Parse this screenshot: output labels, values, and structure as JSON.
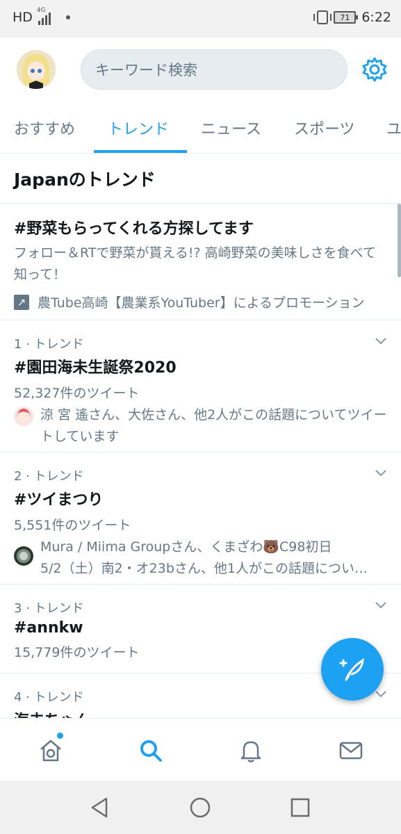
{
  "status_bar": {
    "left_label": "HD",
    "network": "4G",
    "battery": "71",
    "time": "6:22"
  },
  "header": {
    "search_placeholder": "キーワード検索"
  },
  "tabs": [
    {
      "label": "おすすめ"
    },
    {
      "label": "トレンド"
    },
    {
      "label": "ニュース"
    },
    {
      "label": "スポーツ"
    },
    {
      "label": "ユ"
    }
  ],
  "section_title": "Japanのトレンド",
  "promo": {
    "title": "#野菜もらってくれる方探してます",
    "description": "フォロー＆RTで野菜が貰える!? 高崎野菜の美味しさを食べて知って！",
    "promoted_by": "農Tube高崎【農業系YouTuber】によるプロモーション"
  },
  "trends": [
    {
      "rank": "1 · トレンド",
      "name": "#園田海未生誕祭2020",
      "count": "52,327件のツイート",
      "context": "涼 宮 遙さん、大佐さん、他2人がこの話題についてツイートしています"
    },
    {
      "rank": "2 · トレンド",
      "name": "#ツイまつり",
      "count": "5,551件のツイート",
      "context_line1": "Mura / Miima Groupさん、くまざわ🐻C98初日",
      "context_line2": "5/2（土）南2・オ23bさん、他1人がこの話題につい…"
    },
    {
      "rank": "3 · トレンド",
      "name": "#annkw",
      "count": "15,779件のツイート"
    },
    {
      "rank": "4 · トレンド",
      "name": "海未ちゃん"
    }
  ],
  "colors": {
    "accent": "#1da1f2",
    "secondary_text": "#657786",
    "divider": "#e6ecf0"
  }
}
